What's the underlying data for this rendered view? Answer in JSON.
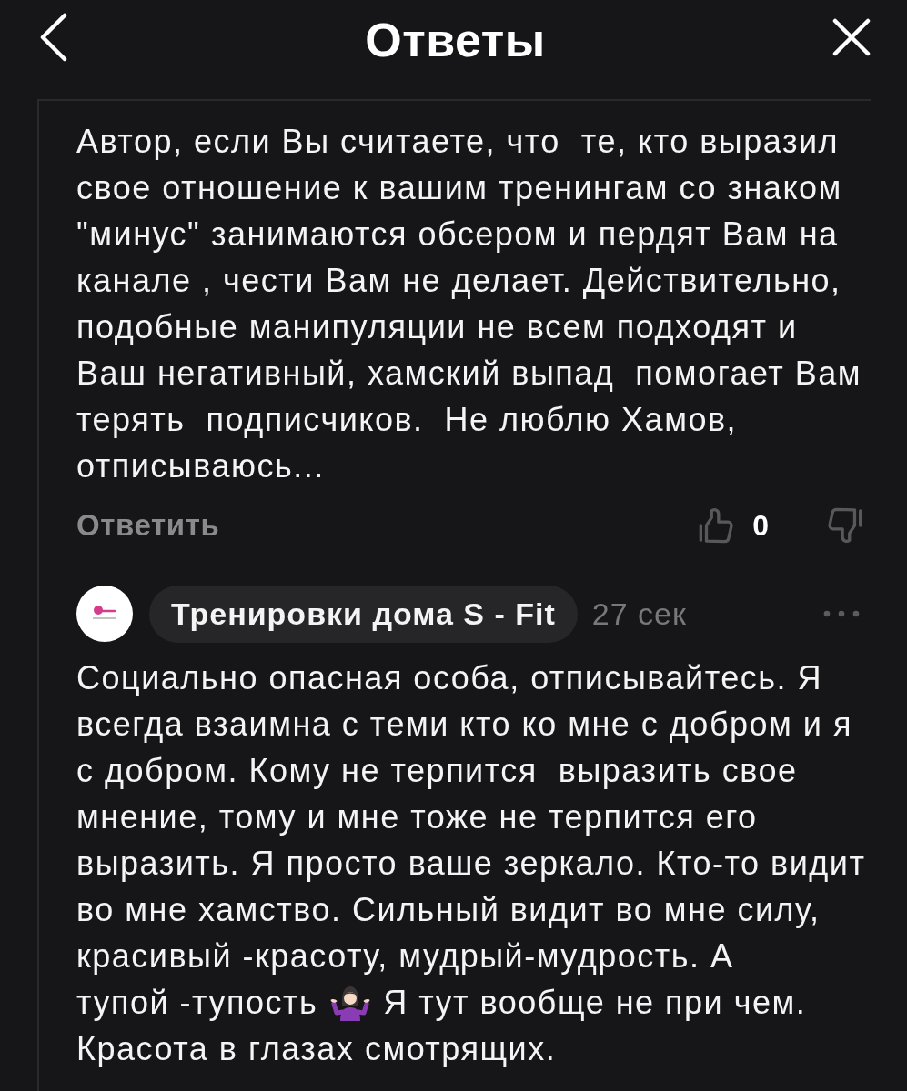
{
  "header": {
    "title": "Ответы"
  },
  "parent_comment": {
    "text": "Автор, если Вы считаете, что  те, кто выразил свое отношение к вашим тренингам со знаком \"минус\" занимаются обсером и пердят Вам на канале , чести Вам не делает. Действительно, подобные манипуляции не всем подходят и Ваш негативный, хамский выпад  помогает Вам терять  подписчиков.  Не люблю Хамов, отписываюсь...",
    "reply_label": "Ответить",
    "likes": "0"
  },
  "reply": {
    "author": "Тренировки дома S - Fit",
    "time": "27 сек",
    "body": [
      {
        "kind": "text",
        "text": "Социально опасная особа, отписывайтесь. Я всегда взаимна с теми кто ко мне с добром и я с добром. Кому не терпится  выразить свое мнение, тому и мне тоже не терпится его выразить. Я просто ваше зеркало. Кто-то видит во мне хамство. Сильный видит во мне силу, красивый -красоту, мудрый-мудрость. А"
      },
      {
        "kind": "inline",
        "parts": [
          {
            "kind": "text",
            "text": "тупой -тупость"
          },
          {
            "kind": "emoji"
          },
          {
            "kind": "text",
            "text": "Я тут вообще не при чем."
          }
        ]
      },
      {
        "kind": "text",
        "text": "Красота в глазах смотрящих."
      }
    ]
  }
}
